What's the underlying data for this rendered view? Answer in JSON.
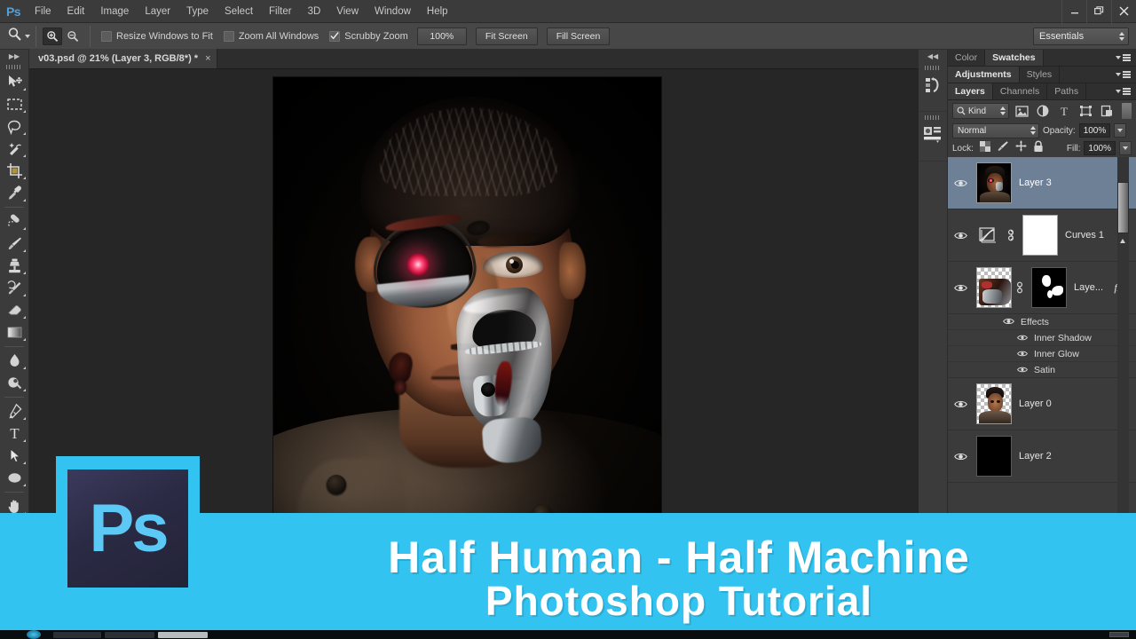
{
  "app": {
    "name": "Photoshop",
    "logo_text": "Ps"
  },
  "menubar": {
    "items": [
      "File",
      "Edit",
      "Image",
      "Layer",
      "Type",
      "Select",
      "Filter",
      "3D",
      "View",
      "Window",
      "Help"
    ],
    "window_controls": [
      "minimize",
      "restore",
      "close"
    ]
  },
  "options_bar": {
    "tool_icon": "zoom-tool-icon",
    "zoom_in_label": "zoom-in-icon",
    "zoom_out_label": "zoom-out-icon",
    "checkboxes": [
      {
        "label": "Resize Windows to Fit",
        "checked": false
      },
      {
        "label": "Zoom All Windows",
        "checked": false
      },
      {
        "label": "Scrubby Zoom",
        "checked": true
      }
    ],
    "buttons": [
      "100%",
      "Fit Screen",
      "Fill Screen"
    ],
    "workspace": "Essentials"
  },
  "toolbar": {
    "tools": [
      {
        "name": "move-tool",
        "icon": "arrow-move"
      },
      {
        "name": "marquee-tool",
        "icon": "dashed-rect"
      },
      {
        "name": "lasso-tool",
        "icon": "lasso"
      },
      {
        "name": "quick-selection-tool",
        "icon": "magic-wand"
      },
      {
        "name": "crop-tool",
        "icon": "crop"
      },
      {
        "name": "eyedropper-tool",
        "icon": "eyedropper"
      },
      {
        "name": "spot-healing-brush-tool",
        "icon": "healing-brush"
      },
      {
        "name": "brush-tool",
        "icon": "brush"
      },
      {
        "name": "clone-stamp-tool",
        "icon": "stamp"
      },
      {
        "name": "history-brush-tool",
        "icon": "history-brush"
      },
      {
        "name": "eraser-tool",
        "icon": "eraser"
      },
      {
        "name": "gradient-tool",
        "icon": "gradient"
      },
      {
        "name": "blur-tool",
        "icon": "droplet"
      },
      {
        "name": "dodge-tool",
        "icon": "dodge"
      },
      {
        "name": "pen-tool",
        "icon": "pen"
      },
      {
        "name": "type-tool",
        "icon": "type-T"
      },
      {
        "name": "path-selection-tool",
        "icon": "black-arrow"
      },
      {
        "name": "ellipse-tool",
        "icon": "ellipse"
      },
      {
        "name": "hand-tool",
        "icon": "hand"
      },
      {
        "name": "zoom-tool",
        "icon": "magnifier",
        "active": true
      }
    ]
  },
  "document": {
    "tab_title": "v03.psd @ 21% (Layer 3, RGB/8*) *",
    "close_glyph": "×",
    "zoom_level": "21%"
  },
  "panel_groups": [
    {
      "tabs": [
        {
          "label": "Color",
          "active": false
        },
        {
          "label": "Swatches",
          "active": true
        }
      ]
    },
    {
      "tabs": [
        {
          "label": "Adjustments",
          "active": true
        },
        {
          "label": "Styles",
          "active": false
        }
      ]
    },
    {
      "tabs": [
        {
          "label": "Layers",
          "active": true
        },
        {
          "label": "Channels",
          "active": false
        },
        {
          "label": "Paths",
          "active": false
        }
      ]
    }
  ],
  "layers_panel": {
    "filter_label": "Kind",
    "filter_icons": [
      "pixel-layers-filter-icon",
      "adjustment-layers-filter-icon",
      "type-layers-filter-icon",
      "shape-layers-filter-icon",
      "smart-object-filter-icon"
    ],
    "blend_mode": "Normal",
    "opacity_label": "Opacity:",
    "opacity_value": "100%",
    "lock_label": "Lock:",
    "lock_icons": [
      "lock-transparent-pixels-icon",
      "lock-image-pixels-icon",
      "lock-position-icon",
      "lock-all-icon"
    ],
    "fill_label": "Fill:",
    "fill_value": "100%",
    "layers": [
      {
        "name": "Layer 3",
        "type": "pixel",
        "visible": true,
        "selected": true,
        "thumb": "photo"
      },
      {
        "name": "Curves 1",
        "type": "adjustment",
        "visible": true,
        "selected": false,
        "thumb": "white-mask",
        "adj_icon": "curves-icon",
        "linked": true
      },
      {
        "name": "Laye...",
        "type": "pixel",
        "visible": true,
        "selected": false,
        "thumb": "checker-photo",
        "mask": "black-mask",
        "linked": true,
        "fx": "fx",
        "effects": {
          "label": "Effects",
          "visible": true,
          "items": [
            {
              "label": "Inner Shadow",
              "visible": true
            },
            {
              "label": "Inner Glow",
              "visible": true
            },
            {
              "label": "Satin",
              "visible": true
            }
          ]
        }
      },
      {
        "name": "Layer 0",
        "type": "pixel",
        "visible": true,
        "selected": false,
        "thumb": "checker-portrait"
      },
      {
        "name": "Layer 2",
        "type": "pixel",
        "visible": true,
        "selected": false,
        "thumb": "black"
      }
    ]
  },
  "banner": {
    "line1": "Half Human - Half Machine",
    "line2": "Photoshop Tutorial",
    "logo_text": "Ps",
    "accent_color": "#33c3f0",
    "logo_bg_color": "#2b2a44",
    "logo_fg_color": "#5cc8f5",
    "text_color": "#ffffff"
  }
}
